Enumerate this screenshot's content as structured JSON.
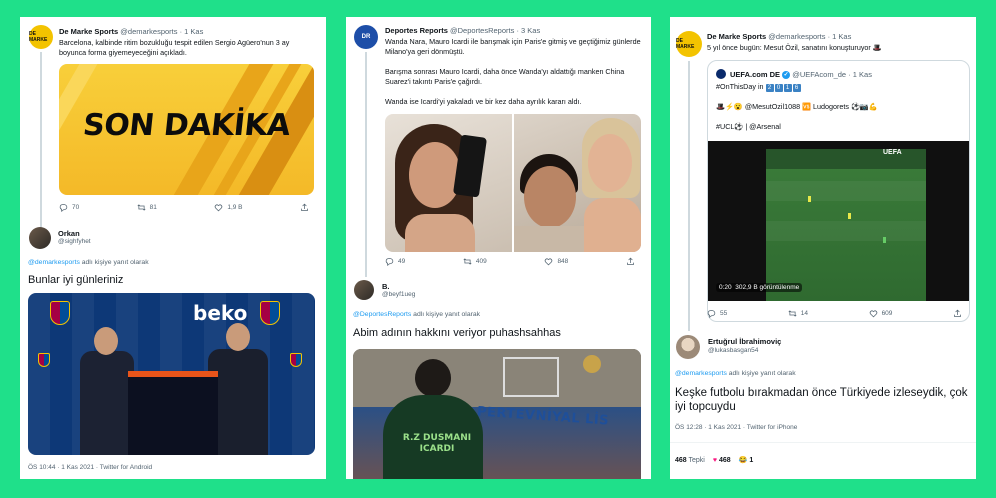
{
  "panel1": {
    "tweet": {
      "author": "De Marke Sports",
      "handle": "@demarkesports",
      "time": "· 1 Kas",
      "avatar_label": "DE MARKE",
      "text": "Barcelona, kalbinde ritim bozukluğu tespit edilen Sergio Agüero'nun 3 ay boyunca forma giyemeyeceğini açıkladı.",
      "image_text": "SON DAKİKA",
      "replies": "70",
      "retweets": "81",
      "likes": "1,9 B"
    },
    "reply": {
      "author": "Orkan",
      "handle": "@sighfyhet",
      "replying_mention": "@demarkesports",
      "replying_suffix": " adlı kişiye yanıt olarak",
      "text": "Bunlar iyi günleriniz",
      "image_brand": "beko",
      "footer": "ÖS 10:44 · 1 Kas 2021 · Twitter for Android"
    }
  },
  "panel2": {
    "tweet": {
      "author": "Deportes Reports",
      "handle": "@DeportesReports",
      "time": "· 3 Kas",
      "avatar_label": "DR",
      "text1": "Wanda Nara, Mauro Icardi ile barışmak için Paris'e gitmiş ve geçtiğimiz günlerde Milano'ya geri dönmüştü.",
      "text2": "Barışma sonrası Mauro Icardi, daha önce Wanda'yı aldattığı manken China Suarez'i takıntı Paris'e çağırdı.",
      "text3": "Wanda ise Icardi'yi yakaladı ve bir kez daha ayrılık kararı aldı.",
      "replies": "49",
      "retweets": "409",
      "likes": "848"
    },
    "reply": {
      "author": "B.",
      "handle": "@beyf1ueg",
      "replying_mention": "@DeportesReports",
      "replying_suffix": " adlı kişiye yanıt olarak",
      "text": "Abim adının hakkını veriyor puhashsahhas",
      "banner": "PERTEVNİYAL LİS",
      "jersey1": "R.Z DUSMANI",
      "jersey2": "ICARDI"
    }
  },
  "panel3": {
    "tweet": {
      "author": "De Marke Sports",
      "handle": "@demarkesports",
      "time": "· 1 Kas",
      "avatar_label": "DE MARKE",
      "text": "5 yıl önce bugün: Mesut Özil, sanatını konuşturuyor 🎩"
    },
    "embed": {
      "author": "UEFA.com DE",
      "handle": "@UEFAcom_de",
      "time": "· 1 Kas",
      "hashtag_prefix": "#OnThisDay in",
      "year_digits": [
        "2",
        "0",
        "1",
        "6"
      ],
      "line2": "🎩⚡😮 @MesutOzil1088 🆚 Ludogorets ⚽📷💪",
      "line3": "#UCL⚽ | @Arsenal",
      "video_time": "0:20",
      "video_views": "302,9 B görüntülenme",
      "video_overlay": "UEFA",
      "replies": "55",
      "retweets": "14",
      "likes": "609"
    },
    "reply": {
      "author": "Ertuğrul İbrahimoviç",
      "handle": "@lukasbasgan54",
      "replying_mention": "@demarkesports",
      "replying_suffix": " adlı kişiye yanıt olarak",
      "text": "Keşke futbolu bırakmadan önce Türkiyede izleseydik, çok iyi topcuydu",
      "footer": "ÖS 12:28 · 1 Kas 2021 · Twitter for iPhone",
      "stat1_num": "468",
      "stat1_label": " Tepki",
      "stat2": "468",
      "stat3": "1"
    }
  },
  "colors": {
    "background": "#1fe08a",
    "link": "#1d9bf0",
    "muted": "#536471"
  }
}
